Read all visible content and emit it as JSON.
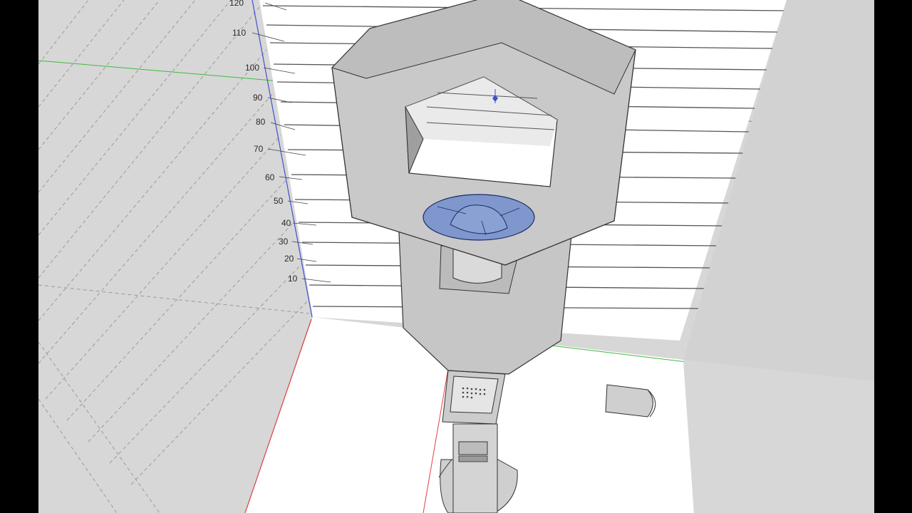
{
  "app": {
    "name": "3D modeling viewport"
  },
  "scale_labels": [
    "120",
    "110",
    "100",
    "90",
    "80",
    "70",
    "60",
    "50",
    "40",
    "30",
    "20",
    "10"
  ],
  "colors": {
    "background_wall": "#d7d7d7",
    "floor": "#ffffff",
    "model_face": "#c9c9c9",
    "model_dark": "#b5b5b5",
    "selected_face": "#7f97cc",
    "axis_red": "#e04040",
    "axis_green": "#3dbb3d",
    "axis_blue": "#4050d0"
  },
  "icons": [
    "axis-origin-marker-icon"
  ]
}
